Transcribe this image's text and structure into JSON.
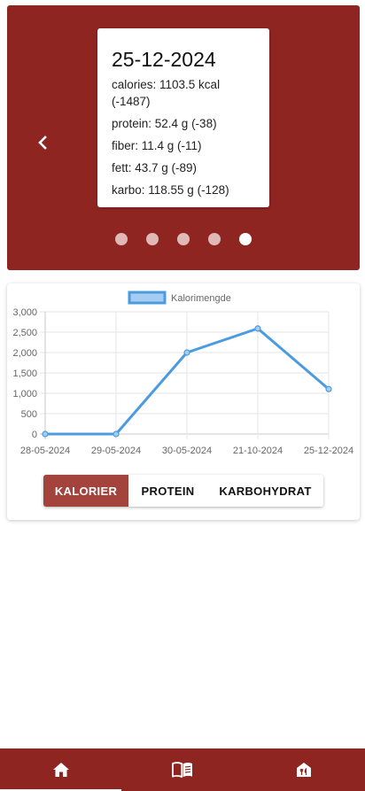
{
  "carousel": {
    "date": "25-12-2024",
    "nutrients": [
      "calories: 1103.5 kcal (-1487)",
      "protein: 52.4 g (-38)",
      "fiber: 11.4 g (-11)",
      "fett: 43.7 g (-89)",
      "karbo: 118.55 g (-128)"
    ],
    "dot_count": 5,
    "active_dot": 5,
    "prev_icon": "chevron-left-icon"
  },
  "toggle": {
    "kalorier": "KALORIER",
    "protein": "PROTEIN",
    "karbohydrat": "KARBOHYDRAT",
    "active": "kalorier"
  },
  "chart_data": {
    "type": "line",
    "x": [
      "28-05-2024",
      "29-05-2024",
      "30-05-2024",
      "21-10-2024",
      "25-12-2024"
    ],
    "series": [
      {
        "name": "Kalorimengde",
        "values": [
          0,
          0,
          2000,
          2590,
          1103.5
        ]
      }
    ],
    "yticks": [
      "0",
      "500",
      "1,000",
      "1,500",
      "2,000",
      "2,500",
      "3,000"
    ],
    "ylim": [
      0,
      3000
    ],
    "grid": true,
    "legend": "top-center",
    "line_color": "#4a9be0",
    "fill_color": "#a6cdf0"
  },
  "bottom_nav": {
    "items": [
      {
        "name": "home-icon",
        "active": true
      },
      {
        "name": "book-icon",
        "active": false
      },
      {
        "name": "restaurant-icon",
        "active": false
      }
    ]
  },
  "colors": {
    "brand": "#8f2521",
    "toggle_active": "#a3433c"
  }
}
